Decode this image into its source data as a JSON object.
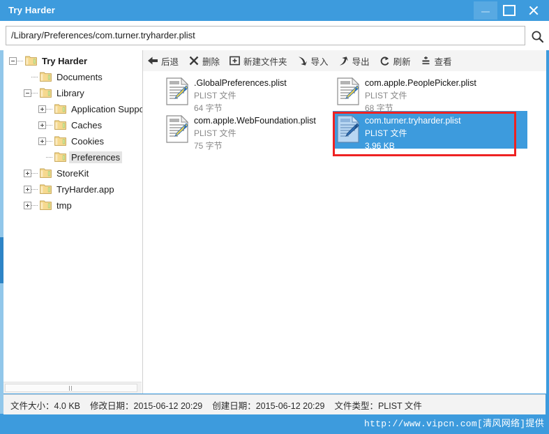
{
  "window": {
    "title": "Try Harder",
    "accent_color": "#3d9bdd",
    "controls": {
      "minimize_label": "–",
      "maximize_label": "□",
      "close_label": "✕"
    }
  },
  "address": {
    "path": "/Library/Preferences/com.turner.tryharder.plist",
    "search_icon": "search-icon"
  },
  "toolbar": {
    "items": [
      {
        "label": "后退",
        "icon": "back-arrow-icon"
      },
      {
        "label": "删除",
        "icon": "delete-cross-icon"
      },
      {
        "label": "新建文件夹",
        "icon": "new-folder-icon"
      },
      {
        "label": "导入",
        "icon": "import-down-arrow-icon"
      },
      {
        "label": "导出",
        "icon": "export-up-arrow-icon"
      },
      {
        "label": "刷新",
        "icon": "refresh-circular-arrow-icon"
      },
      {
        "label": "查看",
        "icon": "view-lines-icon"
      }
    ]
  },
  "tree": {
    "nodes": [
      {
        "label": "Try Harder",
        "depth": 0,
        "toggle": "minus",
        "bold": true,
        "selected": false
      },
      {
        "label": "Documents",
        "depth": 1,
        "toggle": "none",
        "bold": false,
        "selected": false
      },
      {
        "label": "Library",
        "depth": 1,
        "toggle": "minus",
        "bold": false,
        "selected": false
      },
      {
        "label": "Application Suppor",
        "depth": 2,
        "toggle": "plus",
        "bold": false,
        "selected": false
      },
      {
        "label": "Caches",
        "depth": 2,
        "toggle": "plus",
        "bold": false,
        "selected": false
      },
      {
        "label": "Cookies",
        "depth": 2,
        "toggle": "plus",
        "bold": false,
        "selected": false
      },
      {
        "label": "Preferences",
        "depth": 2,
        "toggle": "none",
        "bold": false,
        "selected": true
      },
      {
        "label": "StoreKit",
        "depth": 1,
        "toggle": "plus",
        "bold": false,
        "selected": false
      },
      {
        "label": "TryHarder.app",
        "depth": 1,
        "toggle": "plus",
        "bold": false,
        "selected": false
      },
      {
        "label": "tmp",
        "depth": 1,
        "toggle": "plus",
        "bold": false,
        "selected": false
      }
    ]
  },
  "files": [
    {
      "name": ".GlobalPreferences.plist",
      "type": "PLIST 文件",
      "size": "64 字节",
      "selected": false,
      "col": 0,
      "row": 0
    },
    {
      "name": "com.apple.PeoplePicker.plist",
      "type": "PLIST 文件",
      "size": "68 字节",
      "selected": false,
      "col": 1,
      "row": 0
    },
    {
      "name": "com.apple.WebFoundation.plist",
      "type": "PLIST 文件",
      "size": "75 字节",
      "selected": false,
      "col": 0,
      "row": 1
    },
    {
      "name": "com.turner.tryharder.plist",
      "type": "PLIST 文件",
      "size": "3.96 KB",
      "selected": true,
      "col": 1,
      "row": 1
    }
  ],
  "annotation": {
    "color": "#ee2222",
    "target": "com.turner.tryharder.plist"
  },
  "status": {
    "items": [
      "文件大小：4.0 KB",
      "修改日期：2015-06-12 20:29",
      "创建日期：2015-06-12 20:29",
      "文件类型：PLIST 文件"
    ]
  },
  "watermark": {
    "text": "http://www.vipcn.com[清风网络]提供"
  }
}
